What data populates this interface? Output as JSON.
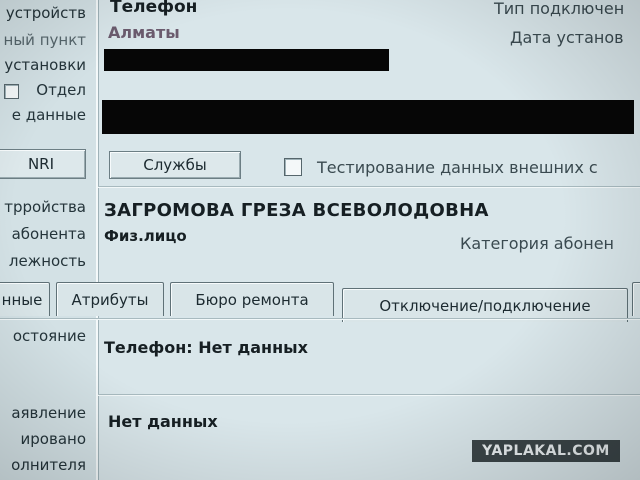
{
  "left_labels": [
    "устройств",
    "ный пункт",
    "установки",
    "Отдел",
    "е данные",
    "трройства",
    "абонента",
    "лежность",
    "остояние",
    "аявление",
    "ировано",
    "олнителя"
  ],
  "nri_button": "NRI",
  "header": {
    "phone_label": "Телефон",
    "city": "Алматы",
    "connection_type_label": "Тип подключен",
    "install_date_label": "Дата установ"
  },
  "services_button": "Службы",
  "external_testing_checkbox": "Тестирование данных внешних с",
  "subscriber": {
    "name": "ЗАГРОМОВА ГРЕЗА ВСЕВОЛОДОВНА",
    "type": "Физ.лицо",
    "category_label": "Категория абонен"
  },
  "tabs": [
    {
      "label": "нные"
    },
    {
      "label": "Атрибуты"
    },
    {
      "label": "Бюро ремонта"
    },
    {
      "label": "Отключение/подключение"
    }
  ],
  "phone_status": "Телефон: Нет данных",
  "no_data": "Нет данных",
  "watermark": "YAPLAKAL.COM",
  "colors": {
    "background": "#d9e6ea",
    "redaction": "#060606",
    "name_text": "#161f23"
  }
}
